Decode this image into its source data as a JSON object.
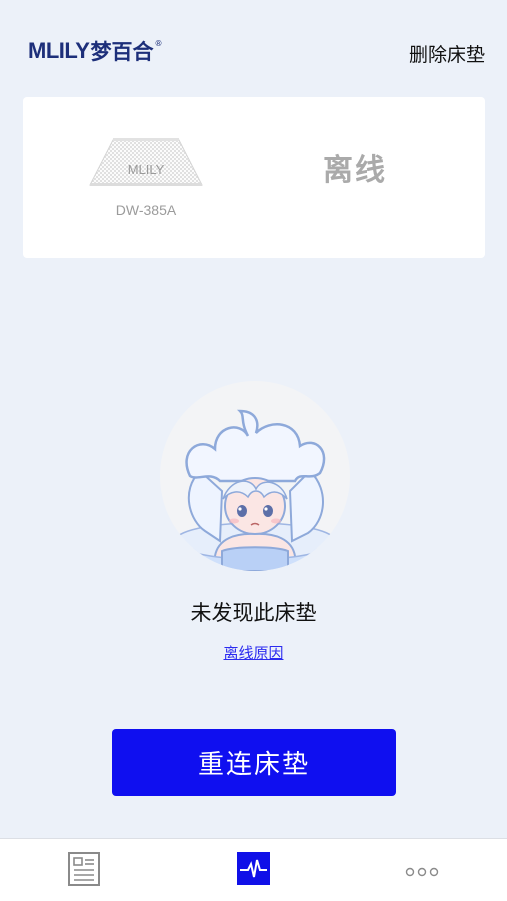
{
  "header": {
    "brand_latin": "MLILY",
    "brand_cn": "梦百合",
    "brand_reg": "®",
    "delete_label": "删除床垫"
  },
  "device": {
    "mattress_brand": "MLILY",
    "model": "DW-385A",
    "status": "离线"
  },
  "main": {
    "message": "未发现此床垫",
    "reason_link": "离线原因",
    "reconnect_label": "重连床垫"
  },
  "tabs": [
    {
      "name": "report",
      "icon": "document-icon",
      "active": false
    },
    {
      "name": "monitor",
      "icon": "heartbeat-icon",
      "active": true
    },
    {
      "name": "more",
      "icon": "more-dots-icon",
      "active": false
    }
  ],
  "colors": {
    "background": "#ecf1f9",
    "brand": "#1d2f7a",
    "accent": "#0f0ff0",
    "status_gray": "#aaaaaa"
  }
}
